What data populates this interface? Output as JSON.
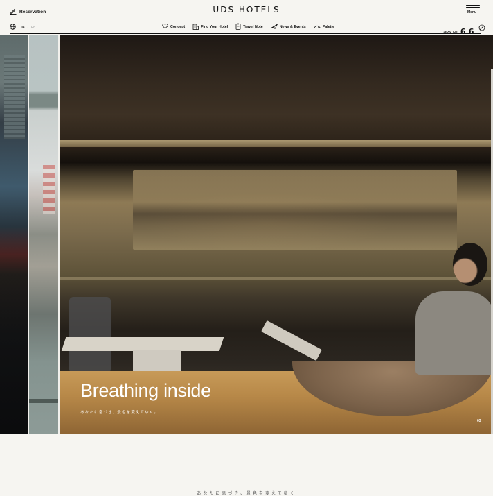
{
  "header": {
    "reservation_label": "Reservation",
    "brand": "UDS HOTELS",
    "menu_label": "Menu"
  },
  "nav": {
    "lang": {
      "active": "Ja",
      "separator": "/",
      "other": "En"
    },
    "items": [
      {
        "label": "Concept",
        "icon": "heart-icon"
      },
      {
        "label": "Find Your Hotel",
        "icon": "hotel-icon"
      },
      {
        "label": "Travel Note",
        "icon": "note-icon"
      },
      {
        "label": "News & Events",
        "icon": "plane-icon"
      },
      {
        "label": "Palette",
        "icon": "palette-icon"
      }
    ],
    "date": {
      "year": "2025",
      "weekday": "Fri.",
      "day": "6.6"
    }
  },
  "hero": {
    "title": "Breathing inside",
    "subtitle": "あなたに息づき、景色を変えてゆく。",
    "slide_number": "03"
  },
  "below": {
    "partial_text": "あなたに息づき、景色を変えてゆく"
  },
  "colors": {
    "background": "#f6f5f1",
    "text": "#111111",
    "hero_text": "#ffffff"
  }
}
